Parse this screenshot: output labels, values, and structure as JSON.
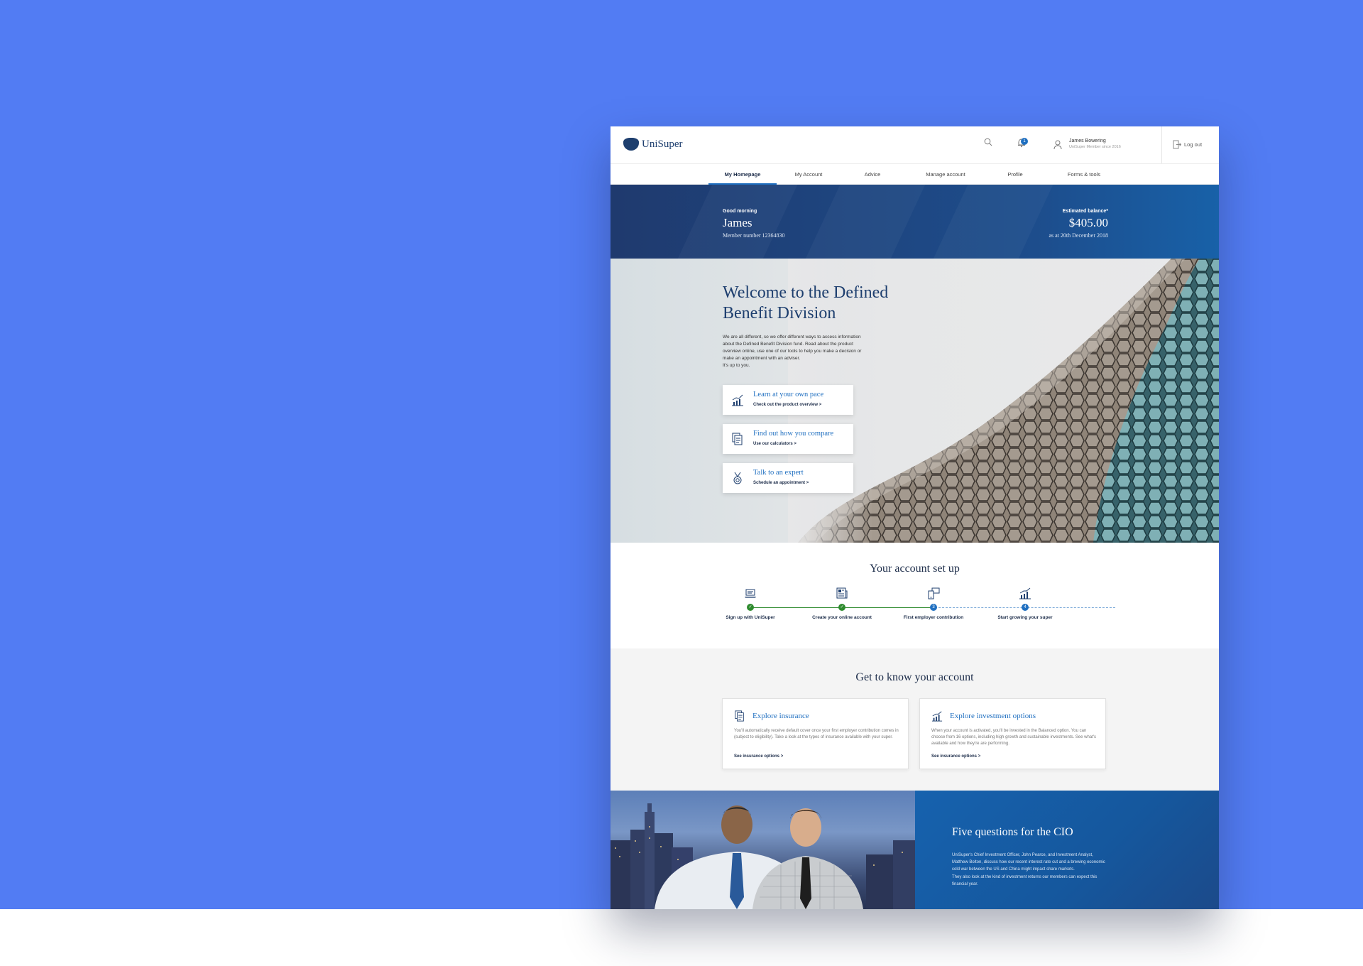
{
  "header": {
    "logo_text": "UniSuper",
    "notification_count": "1",
    "user_name": "James Bowering",
    "user_subtitle": "UniSuper Member since 2016",
    "logout_label": "Log out"
  },
  "nav": {
    "items": [
      {
        "label": "My Homepage",
        "active": true
      },
      {
        "label": "My Account"
      },
      {
        "label": "Advice"
      },
      {
        "label": "Manage account"
      },
      {
        "label": "Profile"
      },
      {
        "label": "Forms & tools"
      }
    ]
  },
  "greeting": {
    "salutation": "Good morning",
    "name": "James",
    "member_number": "Member number 12364830",
    "balance_label": "Estimated balance*",
    "balance_value": "$405.00",
    "balance_date": "as at 20th December 2018"
  },
  "hero": {
    "title": "Welcome to the Defined Benefit Division",
    "body_lines": [
      "We are all different, so we offer different ways to access information",
      "about the Defined Benefit Division fund. Read about the product",
      "overview online, use one of our tools to help you make a decision or",
      "make an appointment with an adviser.",
      "It's up to you."
    ],
    "cards": [
      {
        "title": "Learn at your own pace",
        "link": "Check out the product overview",
        "icon": "growth-chart-icon"
      },
      {
        "title": "Find out how you compare",
        "link": "Use our calculators",
        "icon": "documents-icon"
      },
      {
        "title": "Talk to an expert",
        "link": "Schedule an appointment",
        "icon": "medal-icon"
      }
    ]
  },
  "setup": {
    "title": "Your account set up",
    "steps": [
      {
        "label": "Sign up with UniSuper",
        "status": "done",
        "marker": "✓",
        "icon": "laptop-icon"
      },
      {
        "label": "Create your online account",
        "status": "done",
        "marker": "✓",
        "icon": "newspaper-icon"
      },
      {
        "label": "First employer contribution",
        "status": "pending",
        "marker": "3",
        "icon": "devices-icon"
      },
      {
        "label": "Start growing your super",
        "status": "pending",
        "marker": "4",
        "icon": "growth-chart-icon"
      }
    ],
    "colors": {
      "done": "#2e8b2e",
      "pending": "#1f6fc0"
    }
  },
  "get_to_know": {
    "title": "Get to know your account",
    "cards": [
      {
        "title": "Explore insurance",
        "body": "You'll automatically receive default cover once your first employer contribution comes in (subject to eligibility). Take a look at the types of insurance available with your super.",
        "link": "See insurance options",
        "icon": "documents-icon"
      },
      {
        "title": "Explore investment options",
        "body": "When your account is activated, you'll be invested in the Balanced option. You can choose from 16 options, including high growth and sustainable investments. See what's available and how they're are performing.",
        "link": "See insurance options",
        "icon": "growth-chart-icon"
      }
    ]
  },
  "cio": {
    "title": "Five questions for the CIO",
    "paragraphs": [
      "UniSuper's Chief Investment Officer, John Pearce, and Investment Analyst, Matthew Bolton, discuss how our recent interest rate cut and a brewing economic cold war between the US and China might impact share markets.",
      "They also look at the kind of investment returns our members can expect this financial year."
    ]
  },
  "colors": {
    "page_background": "#527cf3",
    "brand_navy": "#1d3e6e",
    "accent_blue": "#1f6fc0"
  }
}
